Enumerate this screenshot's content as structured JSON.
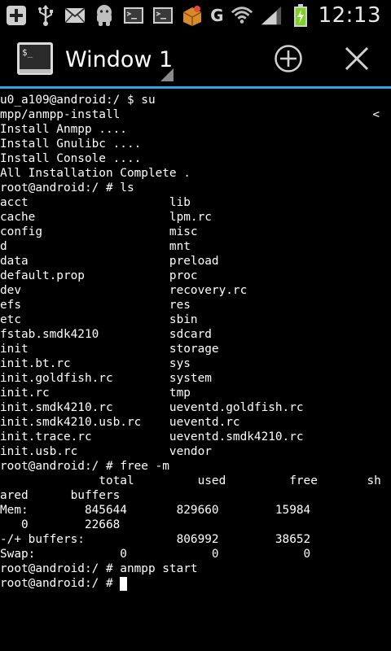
{
  "statusbar": {
    "time": "12:13",
    "g_label": "G",
    "icons": [
      "add-icon",
      "usb-icon",
      "email-icon",
      "android-icon",
      "terminal-icon",
      "terminal-icon",
      "app-icon"
    ],
    "right_icons": [
      "g-icon",
      "wifi-icon",
      "signal-icon",
      "battery-charging-icon"
    ]
  },
  "actionbar": {
    "title": "Window 1",
    "add_icon": "plus-circle-icon",
    "close_icon": "close-icon"
  },
  "terminal": {
    "lines": [
      "u0_a109@android:/ $ su",
      "mpp/anmpp-install",
      "Install Anmpp ....",
      "Install Gnulibc ....",
      "Install Console ....",
      "All Installation Complete .",
      "root@android:/ # ls",
      "acct                    lib",
      "cache                   lpm.rc",
      "config                  misc",
      "d                       mnt",
      "data                    preload",
      "default.prop            proc",
      "dev                     recovery.rc",
      "efs                     res",
      "etc                     sbin",
      "fstab.smdk4210          sdcard",
      "init                    storage",
      "init.bt.rc              sys",
      "init.goldfish.rc        system",
      "init.rc                 tmp",
      "init.smdk4210.rc        ueventd.goldfish.rc",
      "init.smdk4210.usb.rc    ueventd.rc",
      "init.trace.rc           ueventd.smdk4210.rc",
      "init.usb.rc             vendor",
      "root@android:/ # free -m",
      "              total         used         free       sh",
      "ared      buffers",
      "Mem:        845644       829660        15984",
      "   0        22668",
      "-/+ buffers:             806992        38652",
      "Swap:            0            0            0",
      "root@android:/ # anmpp start",
      "root@android:/ # "
    ],
    "wrap_marker": "<"
  },
  "colors": {
    "accent": "#2aa7e6",
    "background": "#000000",
    "text": "#ffffff",
    "battery_green": "#7ed321"
  }
}
